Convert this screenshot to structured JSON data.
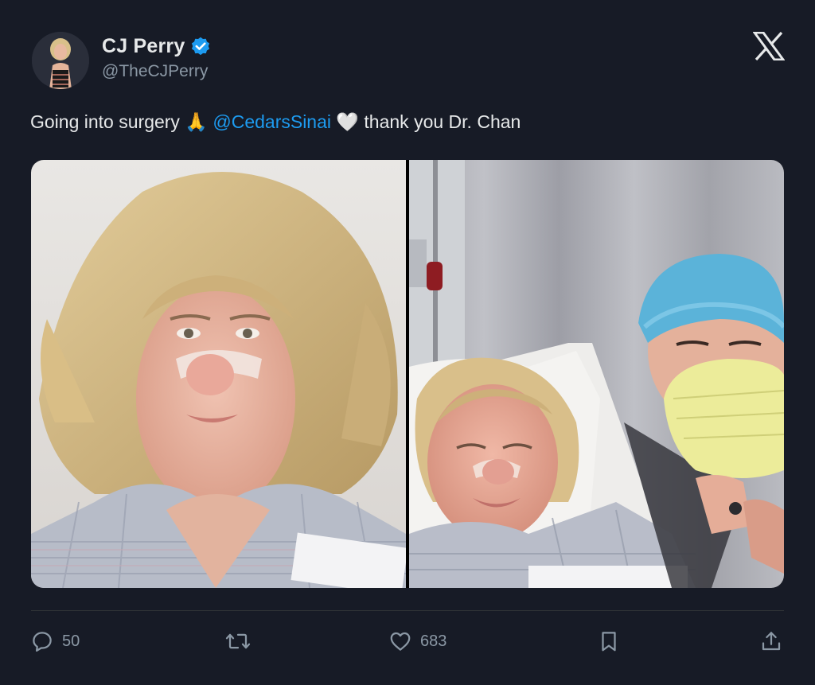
{
  "author": {
    "display_name": "CJ Perry",
    "handle": "@TheCJPerry",
    "verified": true
  },
  "tweet": {
    "text_before": "Going into surgery",
    "emoji_1": "🙏",
    "mention": "@CedarsSinai",
    "emoji_2": "🤍",
    "text_after": "thank you Dr. Chan"
  },
  "media": {
    "count": 2
  },
  "actions": {
    "replies": "50",
    "likes": "683"
  },
  "icons": {
    "platform_logo": "x-logo-icon",
    "verified": "verified-badge-icon",
    "reply": "comment-icon",
    "retweet": "retweet-icon",
    "like": "heart-icon",
    "bookmark": "bookmark-icon",
    "share": "share-icon"
  },
  "colors": {
    "background": "#171b26",
    "text": "#e7e9ea",
    "secondary": "#8b98a5",
    "link": "#1d9bf0",
    "verified": "#1d9bf0"
  }
}
